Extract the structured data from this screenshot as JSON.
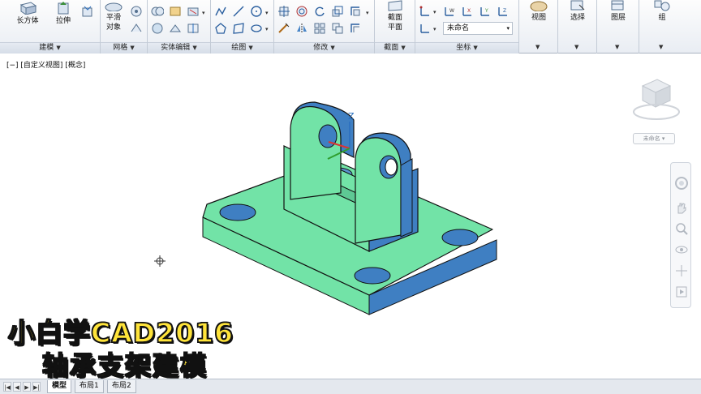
{
  "ribbon": {
    "panels": {
      "modeling": {
        "title": "建模",
        "btn_box": "长方体",
        "btn_extrude": "拉伸"
      },
      "mesh": {
        "title": "网格",
        "btn_smooth_line1": "平滑",
        "btn_smooth_line2": "对象"
      },
      "solid_edit": {
        "title": "实体编辑"
      },
      "draw": {
        "title": "绘图"
      },
      "modify": {
        "title": "修改"
      },
      "section": {
        "title": "截面",
        "btn_section_line1": "截面",
        "btn_section_line2": "平面"
      },
      "coordinates": {
        "title": "坐标",
        "ucs_name": "未命名"
      },
      "view": {
        "title": "视图"
      },
      "select": {
        "title": "选择"
      },
      "layers": {
        "title": "图层"
      },
      "group": {
        "title": "组"
      }
    },
    "panel_arrow": "▼"
  },
  "viewport": {
    "label": "[−] [自定义视图] [概念]",
    "axis_z": "Z",
    "viewcube_wcs": "未命名 ▾"
  },
  "overlay": {
    "line1": "小白学CAD2016",
    "line2": "轴承支架建模"
  },
  "tabs": {
    "nav": [
      "|◀",
      "◀",
      "▶",
      "▶|"
    ],
    "items": [
      "模型",
      "布局1",
      "布局2"
    ]
  },
  "colors": {
    "model_top": "#72e3a7",
    "model_side": "#3f7fc2",
    "model_edge": "#111111",
    "overlay_text": "#ffe43a"
  }
}
